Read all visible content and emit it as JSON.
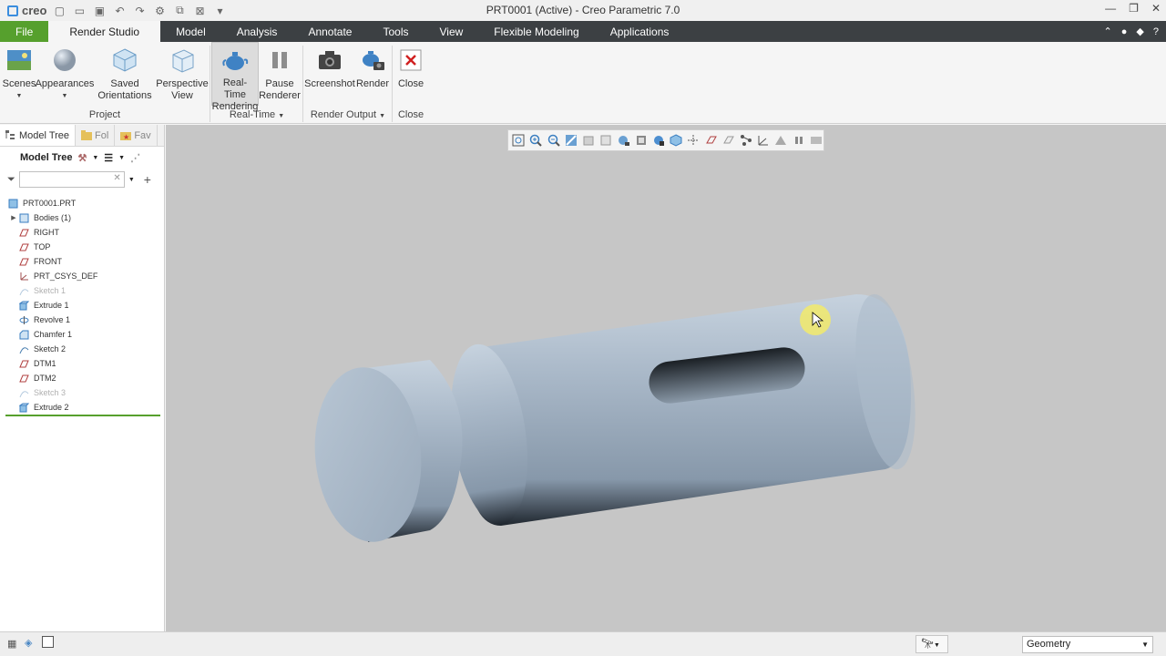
{
  "app": {
    "logo_text": "creo",
    "window_title": "PRT0001 (Active) - Creo Parametric 7.0"
  },
  "tabs": [
    "File",
    "Render Studio",
    "Model",
    "Analysis",
    "Annotate",
    "Tools",
    "View",
    "Flexible Modeling",
    "Applications"
  ],
  "ribbon": {
    "scenes": "Scenes",
    "appearances": "Appearances",
    "saved_orientations_1": "Saved",
    "saved_orientations_2": "Orientations",
    "perspective_1": "Perspective",
    "perspective_2": "View",
    "realtime_1": "Real-Time",
    "realtime_2": "Rendering",
    "pause_1": "Pause",
    "pause_2": "Renderer",
    "screenshot": "Screenshot",
    "render": "Render",
    "close": "Close",
    "groups": {
      "project": "Project",
      "realtime": "Real-Time",
      "render_output": "Render Output",
      "close": "Close"
    }
  },
  "panel": {
    "tabs": [
      "Model Tree",
      "Fol",
      "Fav"
    ],
    "tree_title": "Model Tree",
    "search_placeholder": "",
    "nodes": [
      {
        "label": "PRT0001.PRT",
        "icon": "part-icon",
        "dim": false,
        "expand": false
      },
      {
        "label": "Bodies (1)",
        "icon": "bodies-icon",
        "dim": false,
        "expand": true
      },
      {
        "label": "RIGHT",
        "icon": "datum-plane-icon",
        "dim": false,
        "expand": false
      },
      {
        "label": "TOP",
        "icon": "datum-plane-icon",
        "dim": false,
        "expand": false
      },
      {
        "label": "FRONT",
        "icon": "datum-plane-icon",
        "dim": false,
        "expand": false
      },
      {
        "label": "PRT_CSYS_DEF",
        "icon": "csys-icon",
        "dim": false,
        "expand": false
      },
      {
        "label": "Sketch 1",
        "icon": "sketch-icon",
        "dim": true,
        "expand": false
      },
      {
        "label": "Extrude 1",
        "icon": "extrude-icon",
        "dim": false,
        "expand": false
      },
      {
        "label": "Revolve 1",
        "icon": "revolve-icon",
        "dim": false,
        "expand": false
      },
      {
        "label": "Chamfer 1",
        "icon": "chamfer-icon",
        "dim": false,
        "expand": false
      },
      {
        "label": "Sketch 2",
        "icon": "sketch-icon",
        "dim": false,
        "expand": false
      },
      {
        "label": "DTM1",
        "icon": "datum-plane-icon",
        "dim": false,
        "expand": false
      },
      {
        "label": "DTM2",
        "icon": "datum-plane-icon",
        "dim": false,
        "expand": false
      },
      {
        "label": "Sketch 3",
        "icon": "sketch-icon",
        "dim": true,
        "expand": false
      },
      {
        "label": "Extrude 2",
        "icon": "extrude-icon",
        "dim": false,
        "expand": false
      }
    ]
  },
  "status": {
    "selection_filter": "Geometry"
  },
  "colors": {
    "accent_green": "#56a02d",
    "tab_bar": "#3c4043",
    "viewport": "#c6c6c6",
    "part_blue": "#a3b2c3"
  }
}
